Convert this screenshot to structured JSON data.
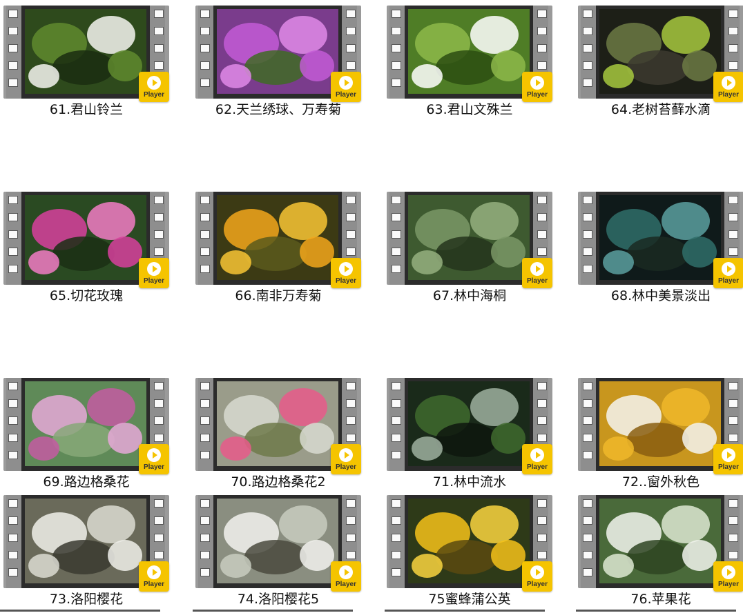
{
  "player_label": "Player",
  "items": [
    {
      "caption": "61.君山铃兰",
      "bg": "#2e4a1c",
      "a": "#5f8a2e",
      "b": "#f4f4f0",
      "c": "#1a2d10"
    },
    {
      "caption": "62.天兰绣球、万寿菊",
      "bg": "#7a3c8c",
      "a": "#c35ad6",
      "b": "#e08ae8",
      "c": "#3f6a24"
    },
    {
      "caption": "63.君山文殊兰",
      "bg": "#4f7d26",
      "a": "#8db84a",
      "b": "#ffffff",
      "c": "#2c4d12"
    },
    {
      "caption": "64.老树苔藓水滴",
      "bg": "#1d1f17",
      "a": "#6c7a44",
      "b": "#a7c93e",
      "c": "#3c3a2f"
    },
    {
      "caption": "65.切花玫瑰",
      "bg": "#2a4a22",
      "a": "#d8409e",
      "b": "#f27bc4",
      "c": "#1b2f14"
    },
    {
      "caption": "66.南非万寿菊",
      "bg": "#3c3a14",
      "a": "#f2a71b",
      "b": "#f8c534",
      "c": "#5a5a1c"
    },
    {
      "caption": "67.林中海桐",
      "bg": "#3e5a30",
      "a": "#7a9866",
      "b": "#95b07f",
      "c": "#24351c"
    },
    {
      "caption": "68.林中美景淡出",
      "bg": "#0f1a1a",
      "a": "#2f6e6a",
      "b": "#5aa0a0",
      "c": "#1a2a22"
    },
    {
      "caption": "69.路边格桑花",
      "bg": "#5f8a58",
      "a": "#e6a8d8",
      "b": "#c45aa2",
      "c": "#87a878"
    },
    {
      "caption": "70.路边格桑花2",
      "bg": "#9a9c8a",
      "a": "#d8dad0",
      "b": "#e85a8a",
      "c": "#6e7a4a"
    },
    {
      "caption": "71.林中流水",
      "bg": "#1a2a1a",
      "a": "#3f6a2e",
      "b": "#9fb0a0",
      "c": "#0e160e"
    },
    {
      "caption": "72..窗外秋色",
      "bg": "#c8961e",
      "a": "#f5f5f0",
      "b": "#f0b92a",
      "c": "#8a5e10"
    },
    {
      "caption": "73.洛阳樱花",
      "bg": "#6a6a5a",
      "a": "#f0f0ea",
      "b": "#dcdcd2",
      "c": "#3a3a30"
    },
    {
      "caption": "74.洛阳樱花5",
      "bg": "#8a8e80",
      "a": "#f2f2ee",
      "b": "#c8ccc0",
      "c": "#4a4a3e"
    },
    {
      "caption": "75蜜蜂蒲公英",
      "bg": "#2e3a18",
      "a": "#f5c21a",
      "b": "#f9d540",
      "c": "#5a4a10"
    },
    {
      "caption": "76.苹果花",
      "bg": "#4a6a3a",
      "a": "#f2f4ee",
      "b": "#dde8d2",
      "c": "#2e4422"
    }
  ]
}
